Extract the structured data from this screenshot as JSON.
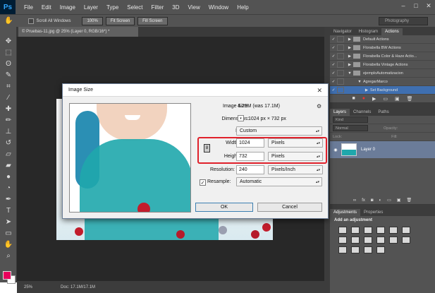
{
  "app": {
    "logo": "Ps",
    "menu": [
      "File",
      "Edit",
      "Image",
      "Layer",
      "Type",
      "Select",
      "Filter",
      "3D",
      "View",
      "Window",
      "Help"
    ],
    "window_controls": [
      "–",
      "□",
      "✕"
    ]
  },
  "options_bar": {
    "scroll_all_label": "Scroll All Windows",
    "btn_100": "100%",
    "btn_fit": "Fit Screen",
    "btn_fill": "Fill Screen",
    "workspace": "Photography"
  },
  "document": {
    "tab_title": "© Pruebas-11.jpg @ 25% (Layer 0, RGB/16*) *"
  },
  "status": {
    "zoom": "25%",
    "doc": "Doc: 17.1M/17.1M"
  },
  "panels": {
    "top_tabs": [
      "Navigator",
      "Histogram",
      "Actions"
    ],
    "actions": [
      {
        "label": "Default Actions",
        "check": "✓",
        "expander": "▶"
      },
      {
        "label": "Florabella BW Actions",
        "check": "✓",
        "expander": "▶"
      },
      {
        "label": "Florabella Color & Haze Actio...",
        "check": "✓",
        "expander": "▶"
      },
      {
        "label": "Florabella Vintage Actions",
        "check": "✓",
        "expander": "▶"
      },
      {
        "label": "ejemploAutomatizacion",
        "check": "✓",
        "expander": "▼"
      },
      {
        "label": "AgregarMarco",
        "check": "✓",
        "expander": "▼"
      },
      {
        "label": "Set Background",
        "check": "✓",
        "expander": "▶"
      }
    ],
    "layer_tabs": [
      "Layers",
      "Channels",
      "Paths"
    ],
    "kind": "Kind",
    "blend": "Normal",
    "opacity_label": "Opacity:",
    "lock_label": "Lock:",
    "fill_label": "Fill:",
    "layer_name": "Layer 0",
    "adj_tabs": [
      "Adjustments",
      "Properties"
    ],
    "adj_title": "Add an adjustment"
  },
  "dialog": {
    "title": "Image Size",
    "image_size_label": "Image Size:",
    "image_size_value": "4.29M (was 17.1M)",
    "dimensions_label": "Dimensions:",
    "dimensions_value": "1024 px  ×  732 px",
    "fit_to_label": "Fit To:",
    "fit_to_value": "Custom",
    "width_label": "Width:",
    "width_value": "1024",
    "width_unit": "Pixels",
    "height_label": "Height:",
    "height_value": "732",
    "height_unit": "Pixels",
    "resolution_label": "Resolution:",
    "resolution_value": "240",
    "resolution_unit": "Pixels/Inch",
    "resample_label": "Resample:",
    "resample_value": "Automatic",
    "ok": "OK",
    "cancel": "Cancel"
  },
  "colors": {
    "highlight": "#e0212b",
    "fg": "#e8005c",
    "selection": "#3f6fb0"
  }
}
